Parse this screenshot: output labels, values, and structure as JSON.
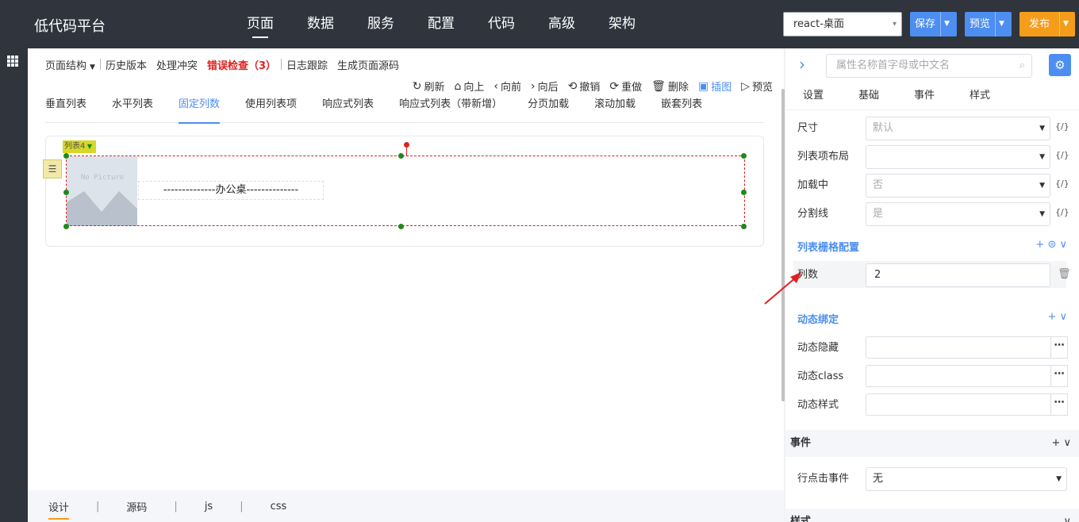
{
  "app": {
    "brand": "低代码平台",
    "nav": [
      "页面",
      "数据",
      "服务",
      "配置",
      "代码",
      "高级",
      "架构"
    ],
    "platform": "react-桌面",
    "save": "保存",
    "preview": "预览",
    "publish": "发布"
  },
  "toolbar": {
    "structure": "页面结构",
    "history": "历史版本",
    "conflict": "处理冲突",
    "errors": "错误检查（3）",
    "log": "日志跟踪",
    "source": "生成页面源码"
  },
  "actions": {
    "refresh": "刷新",
    "up": "向上",
    "forward": "向前",
    "backward": "向后",
    "undo": "撤销",
    "redo": "重做",
    "delete": "删除",
    "insert_image": "插图",
    "preview": "预览"
  },
  "tabs": [
    "垂直列表",
    "水平列表",
    "固定列数",
    "使用列表项",
    "响应式列表",
    "响应式列表（带新增）",
    "分页加载",
    "滚动加载",
    "嵌套列表"
  ],
  "canvas": {
    "list_tag": "列表4",
    "no_picture": "No Picture",
    "item_label": "--------------办公桌--------------"
  },
  "bottom_tabs": [
    "设计",
    "源码",
    "js",
    "css"
  ],
  "panel": {
    "search_placeholder": "属性名称首字母或中文名",
    "tabs": [
      "设置",
      "基础",
      "事件",
      "样式"
    ],
    "size_label": "尺寸",
    "size_value": "默认",
    "layout_label": "列表项布局",
    "layout_value": "",
    "loading_label": "加载中",
    "loading_value": "否",
    "divider_label": "分割线",
    "divider_value": "是",
    "fx": "{/}",
    "grid_section": "列表栅格配置",
    "columns_label": "列数",
    "columns_value": "2",
    "dynamic_section": "动态绑定",
    "dyn_hidden": "动态隐藏",
    "dyn_class": "动态class",
    "dyn_style": "动态样式",
    "events_section": "事件",
    "row_click_label": "行点击事件",
    "row_click_value": "无",
    "style_section": "样式"
  },
  "colors": {
    "accent": "#4d8ef0",
    "publish": "#f59d1a",
    "error": "#e02020",
    "topbar": "#2f343d"
  }
}
